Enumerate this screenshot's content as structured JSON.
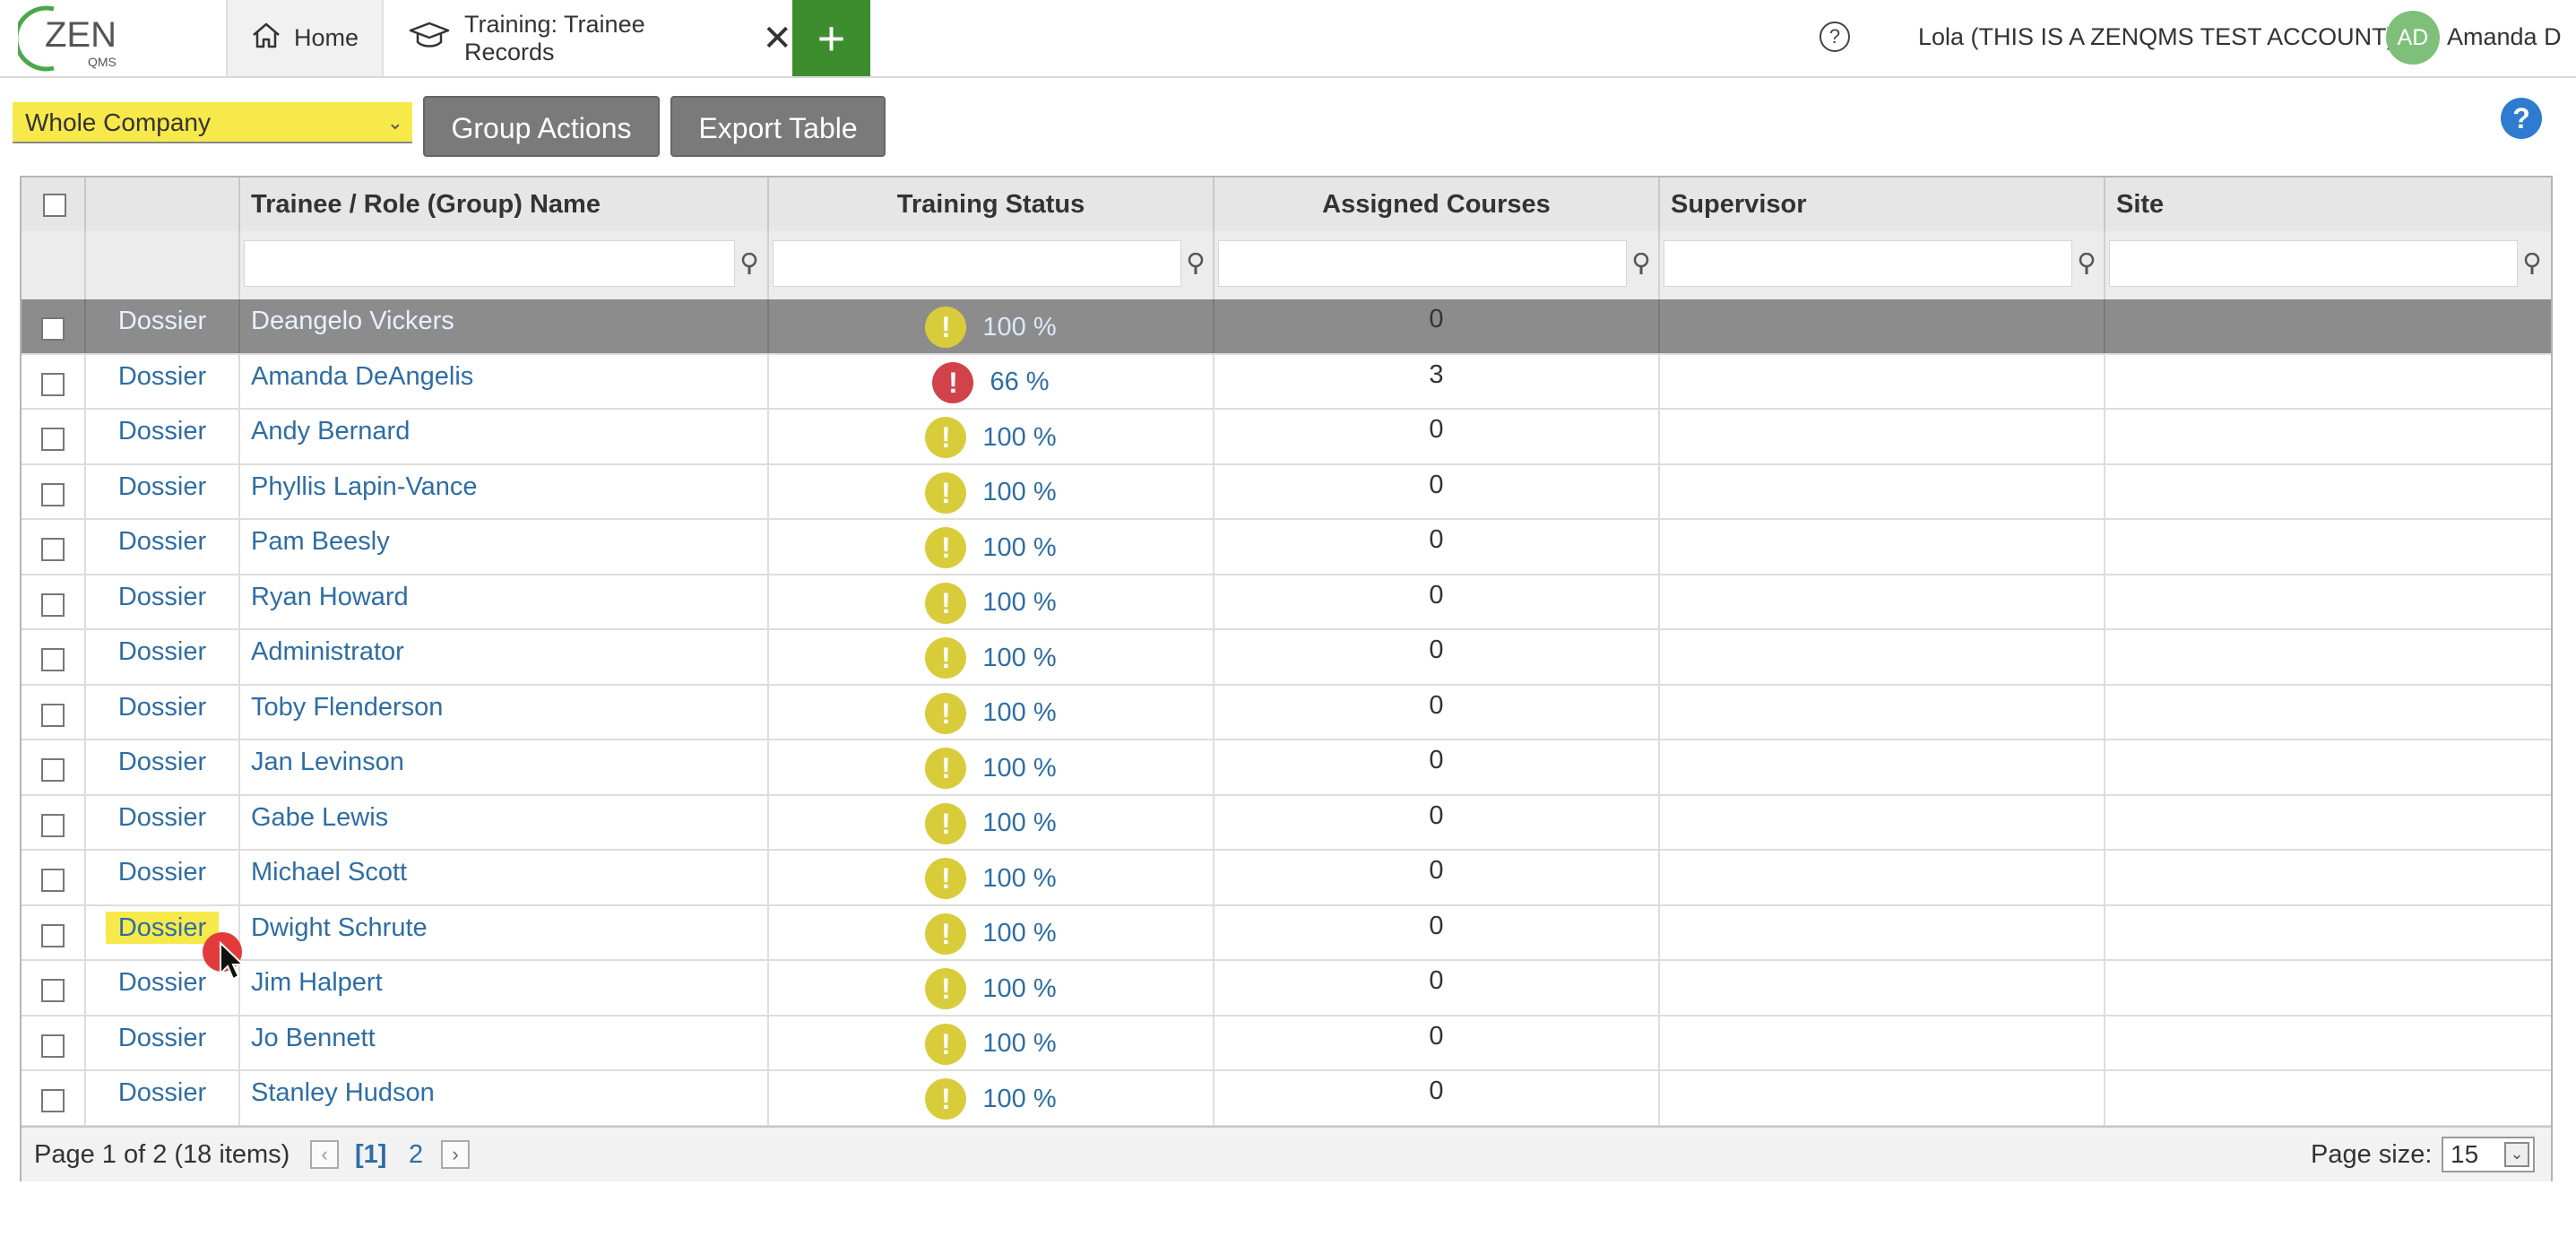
{
  "topbar": {
    "logo_text": "ZEN",
    "logo_sub": "QMS",
    "home_tab": "Home",
    "training_tab": "Training: Trainee Records",
    "account": "Lola (THIS IS A ZENQMS TEST ACCOUNT)",
    "avatar_initials": "AD",
    "user_name": "Amanda D"
  },
  "toolbar": {
    "filter_value": "Whole Company",
    "group_actions": "Group Actions",
    "export_table": "Export Table"
  },
  "table": {
    "headers": {
      "name": "Trainee / Role (Group) Name",
      "status": "Training Status",
      "courses": "Assigned Courses",
      "supervisor": "Supervisor",
      "site": "Site"
    },
    "rows": [
      {
        "dossier": "Dossier",
        "name": "Deangelo Vickers",
        "status": "100 %",
        "status_type": "warning",
        "courses": "0",
        "selected": true
      },
      {
        "dossier": "Dossier",
        "name": "Amanda DeAngelis",
        "status": "66 %",
        "status_type": "error",
        "courses": "3"
      },
      {
        "dossier": "Dossier",
        "name": "Andy Bernard",
        "status": "100 %",
        "status_type": "warning",
        "courses": "0"
      },
      {
        "dossier": "Dossier",
        "name": "Phyllis Lapin-Vance",
        "status": "100 %",
        "status_type": "warning",
        "courses": "0"
      },
      {
        "dossier": "Dossier",
        "name": "Pam Beesly",
        "status": "100 %",
        "status_type": "warning",
        "courses": "0"
      },
      {
        "dossier": "Dossier",
        "name": "Ryan Howard",
        "status": "100 %",
        "status_type": "warning",
        "courses": "0"
      },
      {
        "dossier": "Dossier",
        "name": "Administrator",
        "status": "100 %",
        "status_type": "warning",
        "courses": "0"
      },
      {
        "dossier": "Dossier",
        "name": "Toby Flenderson",
        "status": "100 %",
        "status_type": "warning",
        "courses": "0"
      },
      {
        "dossier": "Dossier",
        "name": "Jan Levinson",
        "status": "100 %",
        "status_type": "warning",
        "courses": "0"
      },
      {
        "dossier": "Dossier",
        "name": "Gabe Lewis",
        "status": "100 %",
        "status_type": "warning",
        "courses": "0"
      },
      {
        "dossier": "Dossier",
        "name": "Michael Scott",
        "status": "100 %",
        "status_type": "warning",
        "courses": "0"
      },
      {
        "dossier": "Dossier",
        "name": "Dwight Schrute",
        "status": "100 %",
        "status_type": "warning",
        "courses": "0",
        "highlighted": true
      },
      {
        "dossier": "Dossier",
        "name": "Jim Halpert",
        "status": "100 %",
        "status_type": "warning",
        "courses": "0"
      },
      {
        "dossier": "Dossier",
        "name": "Jo Bennett",
        "status": "100 %",
        "status_type": "warning",
        "courses": "0"
      },
      {
        "dossier": "Dossier",
        "name": "Stanley Hudson",
        "status": "100 %",
        "status_type": "warning",
        "courses": "0"
      }
    ]
  },
  "pager": {
    "info": "Page 1 of 2 (18 items)",
    "current_page": "[1]",
    "next_page": "2",
    "page_size_label": "Page size:",
    "page_size": "15"
  },
  "colors": {
    "add_tab": "#3d8d2e",
    "filter_highlight": "#f7e94a",
    "warning": "#d9cc3b",
    "error": "#d2424a",
    "link": "#2e6da4"
  }
}
